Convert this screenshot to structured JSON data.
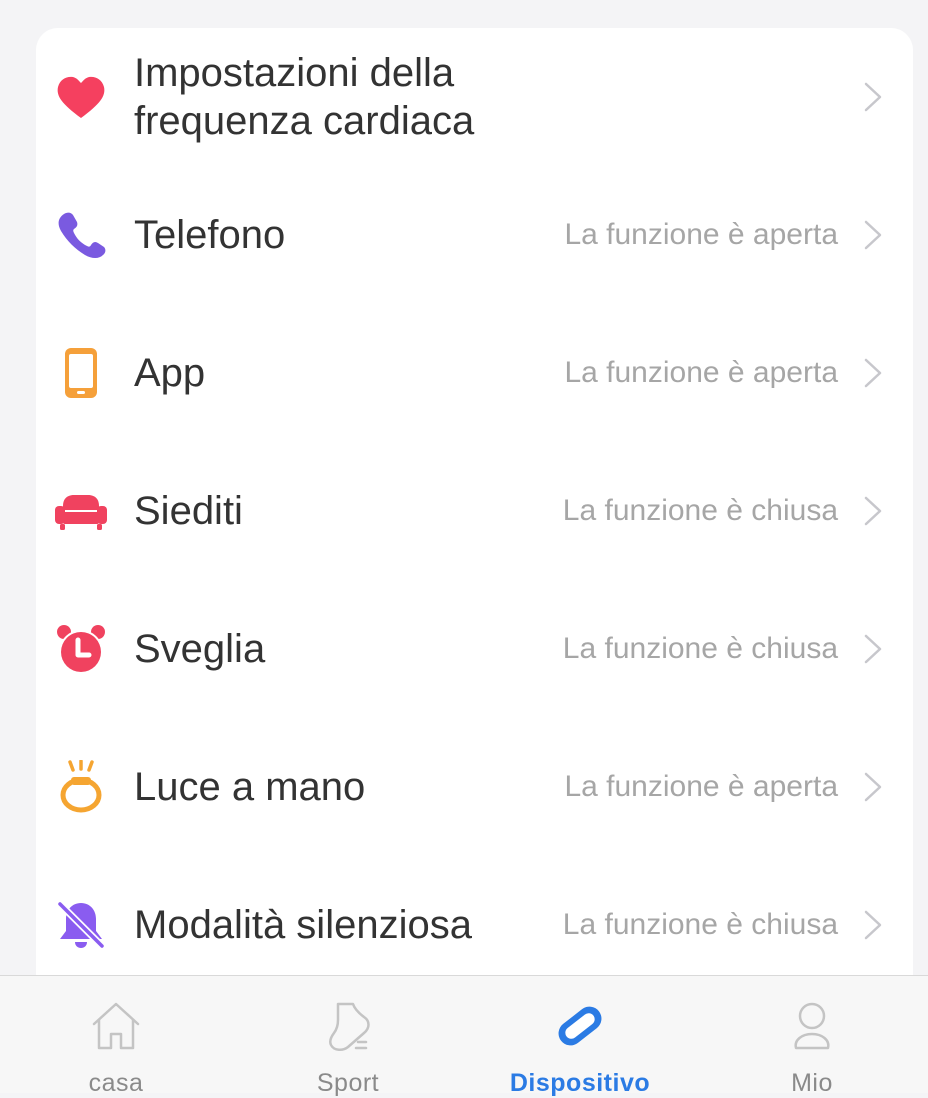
{
  "settings": {
    "items": [
      {
        "icon": "heart-icon",
        "label": "Impostazioni della frequenza cardiaca",
        "status": ""
      },
      {
        "icon": "phone-icon",
        "label": "Telefono",
        "status": "La funzione è aperta"
      },
      {
        "icon": "smartphone-icon",
        "label": "App",
        "status": "La funzione è aperta"
      },
      {
        "icon": "sofa-icon",
        "label": "Siediti",
        "status": "La funzione è chiusa"
      },
      {
        "icon": "alarm-clock-icon",
        "label": "Sveglia",
        "status": "La funzione è chiusa"
      },
      {
        "icon": "wrist-light-icon",
        "label": "Luce a mano",
        "status": "La funzione è aperta"
      },
      {
        "icon": "bell-off-icon",
        "label": "Modalità silenziosa",
        "status": "La funzione è chiusa"
      }
    ]
  },
  "tabbar": {
    "tabs": [
      {
        "icon": "home-icon",
        "label": "casa",
        "active": false
      },
      {
        "icon": "shoe-icon",
        "label": "Sport",
        "active": false
      },
      {
        "icon": "band-icon",
        "label": "Dispositivo",
        "active": true
      },
      {
        "icon": "person-icon",
        "label": "Mio",
        "active": false
      }
    ]
  },
  "colors": {
    "heart": "#f5405f",
    "phone": "#7a5ae0",
    "smartphone": "#f5a03a",
    "sofa": "#f0425f",
    "alarm": "#f0425f",
    "wrist_light": "#f5a531",
    "bell_off": "#8a5cf0",
    "active_tab": "#2b7be4",
    "inactive_tab": "#8a8a8a",
    "status_text": "#a6a6a6"
  }
}
